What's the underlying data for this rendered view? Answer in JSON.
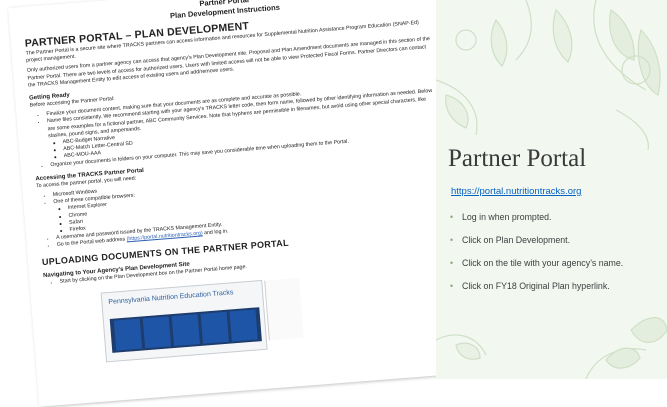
{
  "document": {
    "title_line1": "Partner Portal",
    "title_line2": "Plan Development Instructions",
    "heading": "PARTNER PORTAL – PLAN DEVELOPMENT",
    "intro": "The Partner Portal is a secure site where TRACKS partners can access information and resources for Supplemental Nutrition Assistance Program Education (SNAP-Ed) project management.",
    "access_para": "Only authorized users from a partner agency can access that agency's Plan Development site. Proposal and Plan Amendment documents are managed in this section of the Partner Portal. There are two levels of access for authorized users. Users with limited access will not be able to view Protected Fiscal Forms. Partner Directors can contact the TRACKS Management Entity to edit access of existing users and add/remove users.",
    "getting_ready_heading": "Getting Ready",
    "getting_ready_intro": "Before accessing the Partner Portal:",
    "ready_items": [
      "Finalize your document content, making sure that your documents are as complete and accurate as possible.",
      "Name files consistently. We recommend starting with your agency's TRACKS letter code, then form name, followed by other identifying information as needed. Below are some examples for a fictional partner, ABC Community Services. Note that hyphens are permissible in filenames, but avoid using other special characters, like slashes, pound signs, and ampersands."
    ],
    "filename_examples": [
      "ABC-Budget Narrative",
      "ABC-Match Letter-Central SD",
      "ABC-MOU-AAA"
    ],
    "organize_item": "Organize your documents in folders on your computer. This may save you considerable time when uploading them to the Portal.",
    "accessing_heading": "Accessing the TRACKS Partner Portal",
    "accessing_intro": "To access the partner portal, you will need:",
    "needs": [
      "Microsoft Windows",
      "One of these compatible browsers:"
    ],
    "browsers": [
      "Internet Explorer",
      "Chrome",
      "Safari",
      "Firefox"
    ],
    "needs_more": [
      "A username and password issued by the TRACKS Management Entity.",
      "Go to the Portal web address"
    ],
    "portal_url_in_doc": "(https://portal.nutritiontracks.org)",
    "login_suffix": "and log in.",
    "uploading_heading": "UPLOADING DOCUMENTS ON THE PARTNER PORTAL",
    "navigating_heading": "Navigating to Your Agency's Plan Development Site",
    "navigating_item": "Start by clicking on the Plan Development box on the Partner Portal home page.",
    "screenshot_banner": "Pennsylvania Nutrition Education Tracks"
  },
  "slide": {
    "title": "Partner Portal",
    "link": "https://portal.nutritiontracks.org",
    "bullets": [
      "Log in when prompted.",
      "Click on Plan Development.",
      "Click on the tile with your agency’s name.",
      "Click on FY18 Original Plan hyperlink."
    ]
  },
  "colors": {
    "panel_bg": "#f2f7f0",
    "leaf": "#cfe0c6",
    "link": "#0563c1",
    "title": "#3a3a3a"
  }
}
